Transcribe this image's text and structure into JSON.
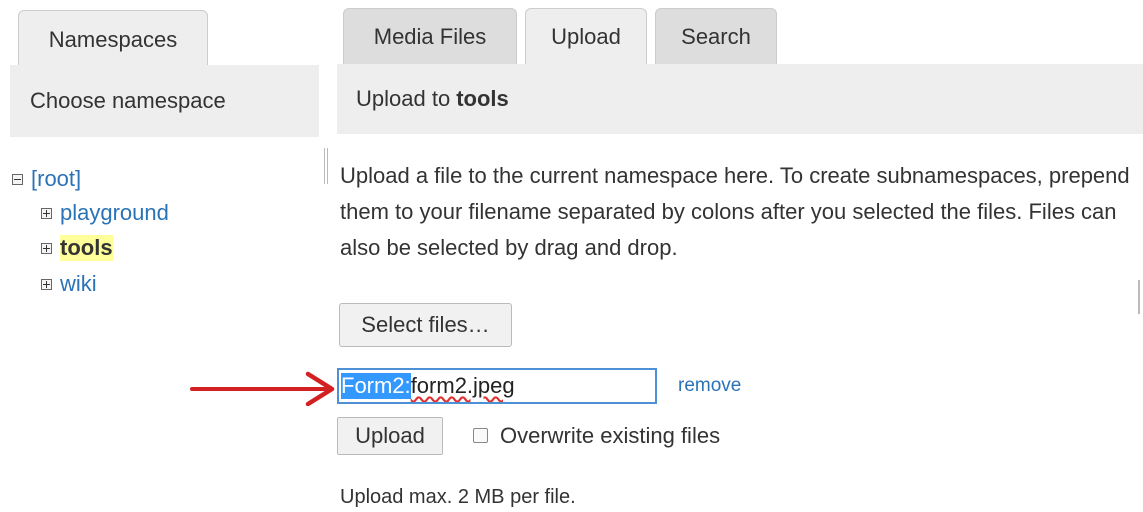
{
  "namespaces_panel": {
    "tab_label": "Namespaces",
    "header": "Choose namespace",
    "tree": [
      {
        "label": "[root]",
        "state": "expanded",
        "current": false
      },
      {
        "label": "playground",
        "state": "collapsed",
        "current": false
      },
      {
        "label": "tools",
        "state": "collapsed",
        "current": true
      },
      {
        "label": "wiki",
        "state": "collapsed",
        "current": false
      }
    ]
  },
  "media_panel": {
    "tabs": [
      {
        "label": "Media Files",
        "active": false
      },
      {
        "label": "Upload",
        "active": true
      },
      {
        "label": "Search",
        "active": false
      }
    ],
    "header_prefix": "Upload to",
    "header_namespace": "tools",
    "intro": "Upload a file to the current namespace here. To create subnamespaces, prepend them to your filename separated by colons after you selected the files. Files can also be selected by drag and drop.",
    "select_files_label": "Select files…",
    "filename": {
      "selected_part": "Form2:",
      "rest_part": "form2.jpeg"
    },
    "remove_label": "remove",
    "upload_label": "Upload",
    "overwrite_label": "Overwrite existing files",
    "overwrite_checked": false,
    "max_note": "Upload max. 2 MB per file."
  },
  "colors": {
    "link": "#2b73b7",
    "panel_bg": "#eeeeee",
    "selection": "#3399ff",
    "annotation_arrow": "#d32020",
    "current_highlight": "#ffff99"
  }
}
